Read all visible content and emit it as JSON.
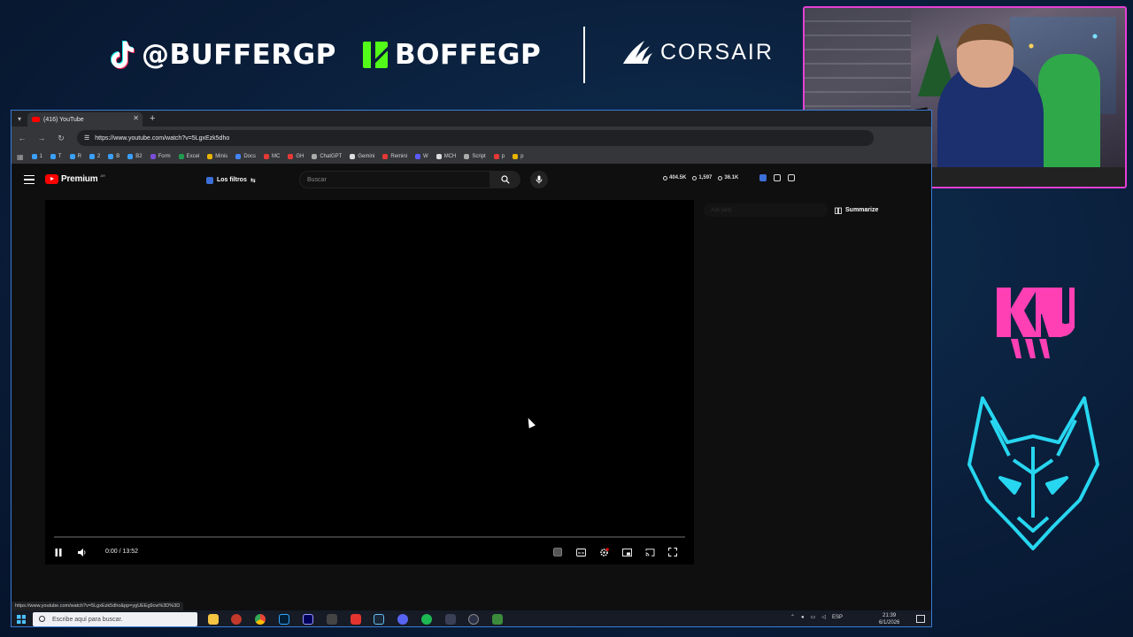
{
  "overlay": {
    "tiktok_handle": "@BUFFERGP",
    "kick_handle": "BOFFEGP",
    "sponsor": "CORSAIR",
    "accent_pink": "#e83fd5",
    "accent_cyan": "#27d6f0",
    "kick_green": "#53fc18"
  },
  "browser": {
    "tab_title": "(416) YouTube",
    "url": "https://www.youtube.com/watch?v=5LgxEzk5dho",
    "bookmarks": [
      {
        "label": "1",
        "color": "#3aa0ff"
      },
      {
        "label": "T",
        "color": "#3aa0ff"
      },
      {
        "label": "R",
        "color": "#3aa0ff"
      },
      {
        "label": "2",
        "color": "#3aa0ff"
      },
      {
        "label": "B",
        "color": "#3aa0ff"
      },
      {
        "label": "B2",
        "color": "#3aa0ff"
      },
      {
        "label": "Form",
        "color": "#7b4dd8"
      },
      {
        "label": "Excel",
        "color": "#1e9b4f"
      },
      {
        "label": "Minis",
        "color": "#e8b400"
      },
      {
        "label": "Docs",
        "color": "#4285f4"
      },
      {
        "label": "MC",
        "color": "#e53935"
      },
      {
        "label": "GH",
        "color": "#e53935"
      },
      {
        "label": "ChatGPT",
        "color": "#aaaaaa"
      },
      {
        "label": "Gemini",
        "color": "#dddddd"
      },
      {
        "label": "Remini",
        "color": "#e53935"
      },
      {
        "label": "W",
        "color": "#5b5bff"
      },
      {
        "label": "MCH",
        "color": "#dddddd"
      },
      {
        "label": "Script",
        "color": "#aaaaaa"
      },
      {
        "label": "p",
        "color": "#e53935"
      },
      {
        "label": "p",
        "color": "#e8b400"
      }
    ],
    "status_url": "https://www.youtube.com/watch?v=5LgxEzk5dho&pp=ygUEEg9cw%3D%3D"
  },
  "youtube": {
    "logo_text": "Premium",
    "logo_sup": "AR",
    "filter_chip": "Los filtros",
    "search_placeholder": "Buscar",
    "stats": [
      "404.5K",
      "1,597",
      "36.1K"
    ],
    "ask_placeholder": "Ask (a/z)",
    "summarize_label": "Summarize"
  },
  "player": {
    "time": "0:00 / 13:52",
    "progress": 0.0
  },
  "taskbar": {
    "search_placeholder": "Escribe aquí para buscar.",
    "language": "ESP",
    "time": "21:39",
    "date": "6/1/2026"
  }
}
